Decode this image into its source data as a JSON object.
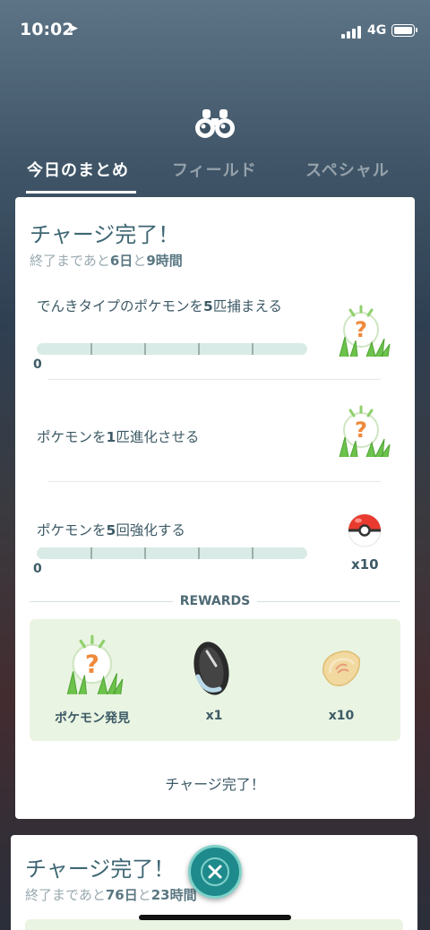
{
  "status": {
    "time": "10:02",
    "network": "4G"
  },
  "tabs": [
    {
      "label": "今日のまとめ",
      "active": true
    },
    {
      "label": "フィールド",
      "active": false
    },
    {
      "label": "スペシャル",
      "active": false
    }
  ],
  "card": {
    "title": "チャージ完了！",
    "sub_prefix": "終了まであと",
    "sub_days": "6日",
    "sub_mid": "と",
    "sub_hours": "9時間",
    "tasks": [
      {
        "pre": "でんきタイプのポケモンを",
        "num": "5",
        "post": "匹捕まえる",
        "progress_label": "0",
        "progress": 0,
        "reward_icon": "mystery-encounter-icon"
      },
      {
        "pre": "ポケモンを",
        "num": "1",
        "post": "匹進化させる",
        "reward_icon": "mystery-encounter-icon"
      },
      {
        "pre": "ポケモンを",
        "num": "5",
        "post": "回強化する",
        "progress_label": "0",
        "progress": 0,
        "reward_icon": "poke-ball-icon",
        "reward_count": "x10"
      }
    ],
    "rewards_title": "REWARDS",
    "rewards": [
      {
        "label": "ポケモン発見",
        "icon": "mystery-encounter-icon"
      },
      {
        "label": "x1",
        "icon": "sinnoh-stone-icon"
      },
      {
        "label": "x10",
        "icon": "rare-candy-icon"
      }
    ],
    "footer": "チャージ完了！"
  },
  "card2": {
    "title": "チャージ完了！",
    "sub_prefix": "終了まであと",
    "sub_days": "76日",
    "sub_mid": "と",
    "sub_hours": "23時間"
  },
  "colors": {
    "accent": "#1f8a8c",
    "reward_bg": "#e9f4e2",
    "progress_track": "#d9ebe6"
  }
}
